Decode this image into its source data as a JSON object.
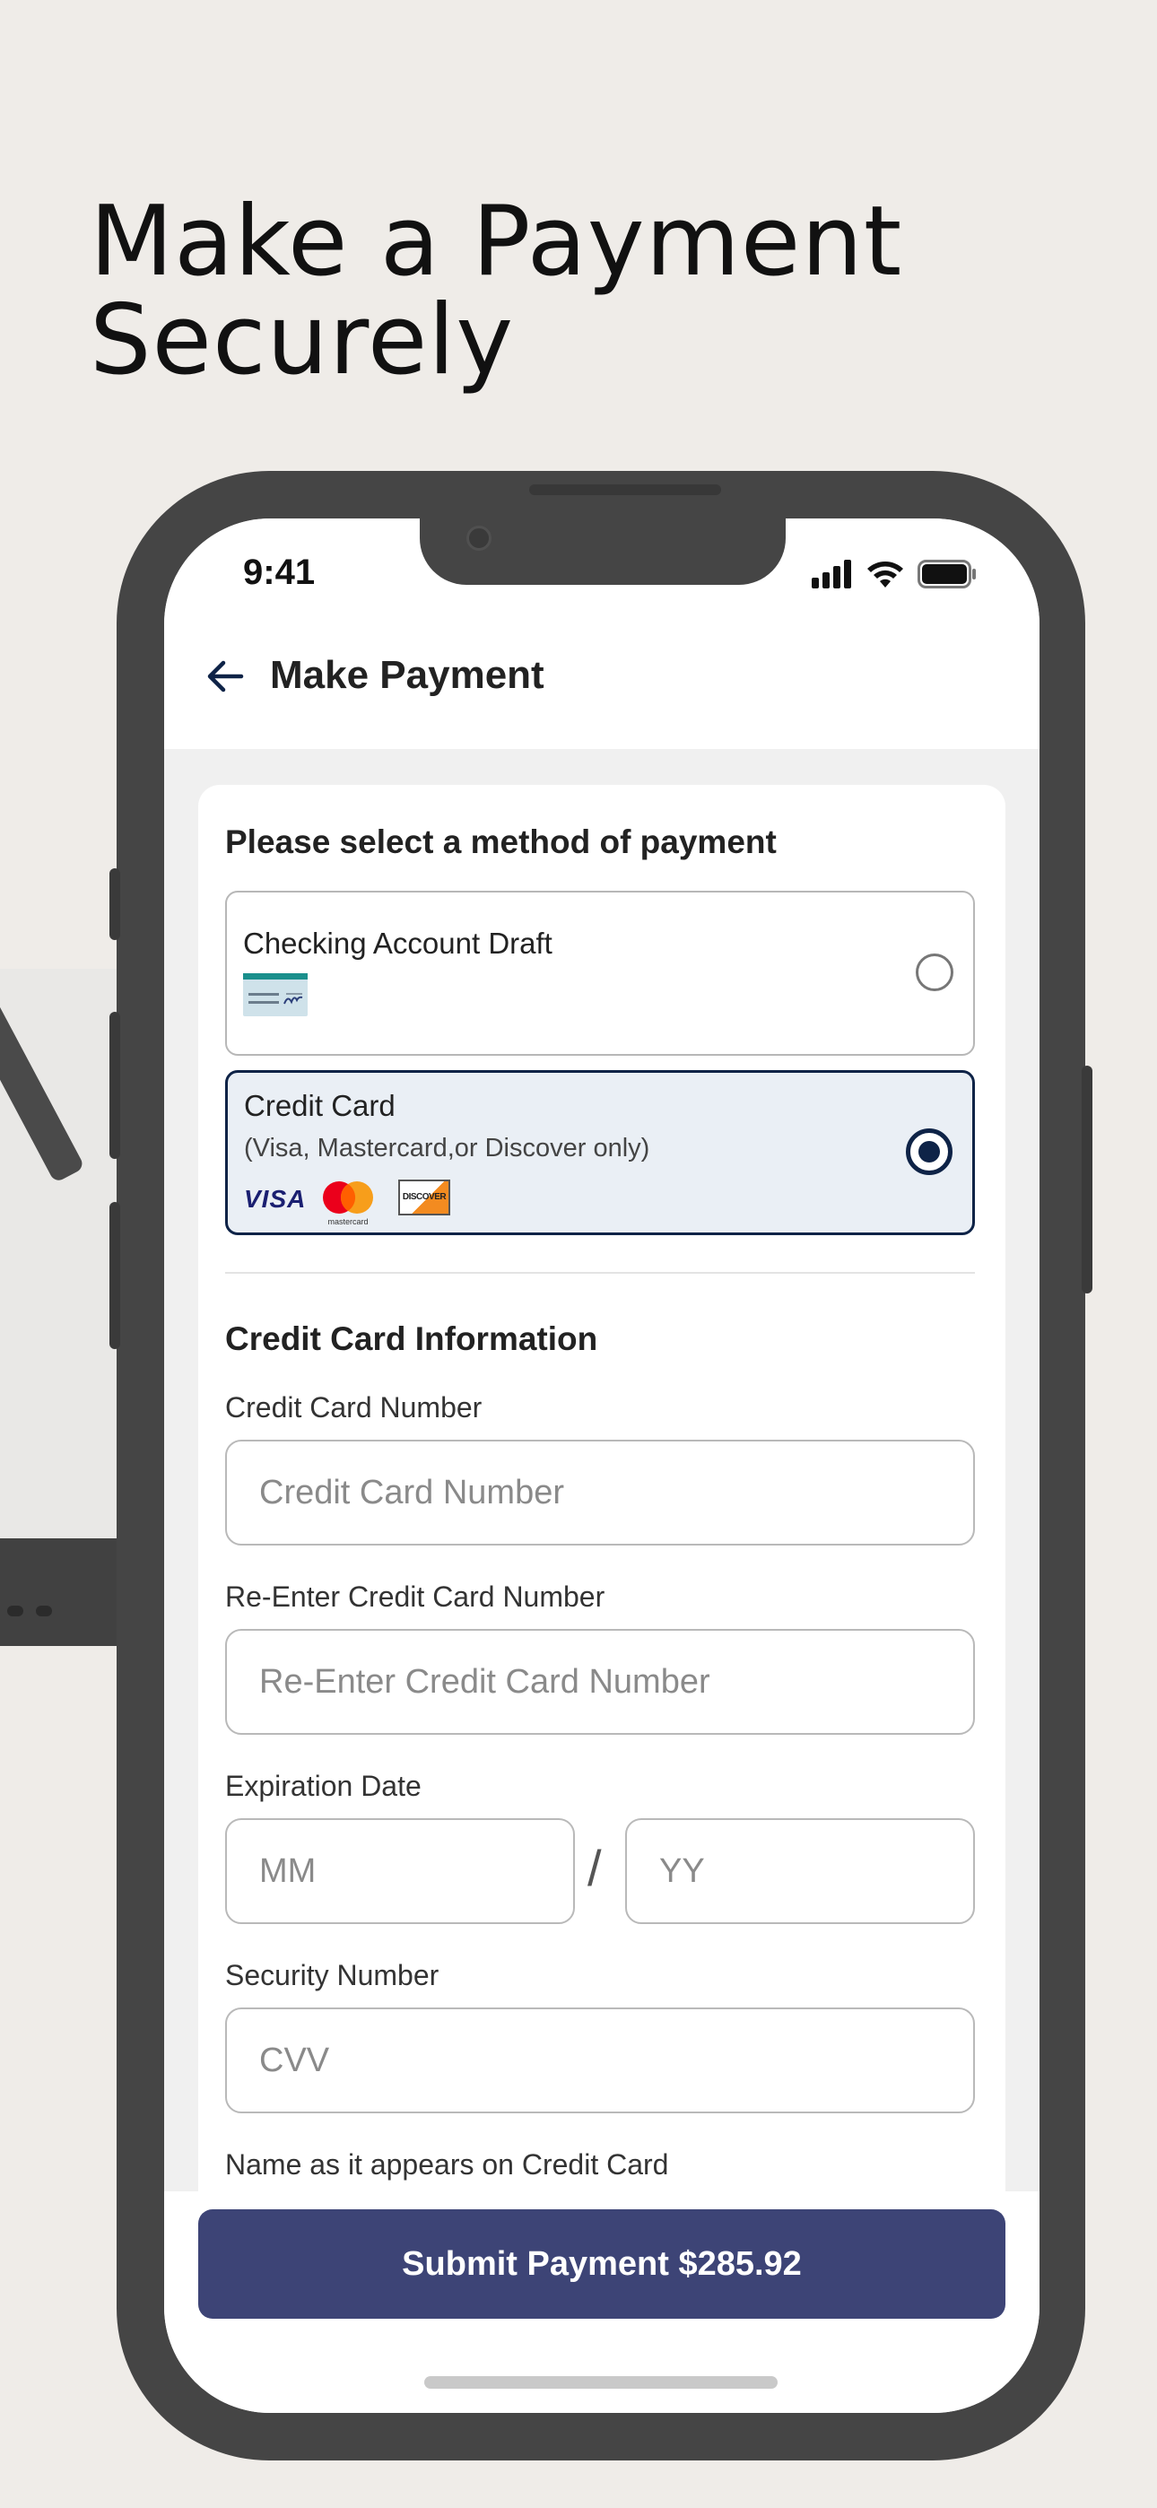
{
  "marketing": {
    "headline_line1": "Make a Payment",
    "headline_line2": "Securely"
  },
  "status_bar": {
    "time": "9:41"
  },
  "header": {
    "title": "Make Payment"
  },
  "payment_methods": {
    "title": "Please select a method of payment",
    "options": [
      {
        "label": "Checking Account Draft",
        "selected": false,
        "icons": [
          "check-icon"
        ]
      },
      {
        "label": "Credit Card",
        "sublabel": "(Visa, Mastercard,or Discover only)",
        "selected": true,
        "logos": {
          "visa": "VISA",
          "mastercard": "mastercard",
          "discover": "DISCOVER"
        }
      }
    ]
  },
  "credit_card_form": {
    "title": "Credit Card Information",
    "card_number": {
      "label": "Credit Card Number",
      "placeholder": "Credit Card Number",
      "value": ""
    },
    "card_number_confirm": {
      "label": "Re-Enter Credit Card Number",
      "placeholder": "Re-Enter Credit Card Number",
      "value": ""
    },
    "expiration": {
      "label": "Expiration Date",
      "month_placeholder": "MM",
      "year_placeholder": "YY",
      "separator": "/"
    },
    "security": {
      "label": "Security Number",
      "placeholder": "CVV",
      "value": ""
    },
    "name_label": "Name as it appears on Credit Card"
  },
  "footer": {
    "submit_label": "Submit Payment $285.92"
  },
  "colors": {
    "background": "#efece8",
    "primary_button": "#3d4476",
    "selected_border": "#0e2347",
    "selected_fill": "#eaeff5"
  }
}
